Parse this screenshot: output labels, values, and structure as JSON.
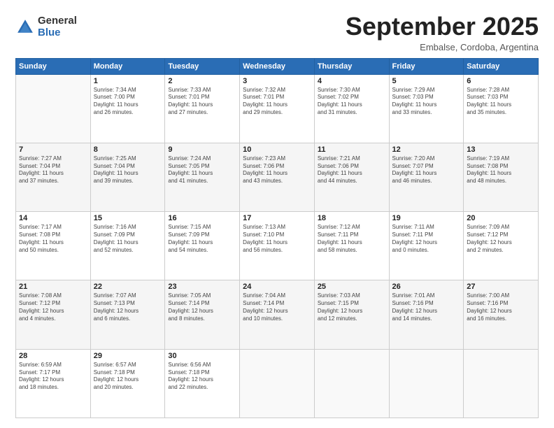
{
  "header": {
    "logo_general": "General",
    "logo_blue": "Blue",
    "title": "September 2025",
    "location": "Embalse, Cordoba, Argentina"
  },
  "days_of_week": [
    "Sunday",
    "Monday",
    "Tuesday",
    "Wednesday",
    "Thursday",
    "Friday",
    "Saturday"
  ],
  "weeks": [
    [
      {
        "day": "",
        "info": ""
      },
      {
        "day": "1",
        "info": "Sunrise: 7:34 AM\nSunset: 7:00 PM\nDaylight: 11 hours\nand 26 minutes."
      },
      {
        "day": "2",
        "info": "Sunrise: 7:33 AM\nSunset: 7:01 PM\nDaylight: 11 hours\nand 27 minutes."
      },
      {
        "day": "3",
        "info": "Sunrise: 7:32 AM\nSunset: 7:01 PM\nDaylight: 11 hours\nand 29 minutes."
      },
      {
        "day": "4",
        "info": "Sunrise: 7:30 AM\nSunset: 7:02 PM\nDaylight: 11 hours\nand 31 minutes."
      },
      {
        "day": "5",
        "info": "Sunrise: 7:29 AM\nSunset: 7:03 PM\nDaylight: 11 hours\nand 33 minutes."
      },
      {
        "day": "6",
        "info": "Sunrise: 7:28 AM\nSunset: 7:03 PM\nDaylight: 11 hours\nand 35 minutes."
      }
    ],
    [
      {
        "day": "7",
        "info": "Sunrise: 7:27 AM\nSunset: 7:04 PM\nDaylight: 11 hours\nand 37 minutes."
      },
      {
        "day": "8",
        "info": "Sunrise: 7:25 AM\nSunset: 7:04 PM\nDaylight: 11 hours\nand 39 minutes."
      },
      {
        "day": "9",
        "info": "Sunrise: 7:24 AM\nSunset: 7:05 PM\nDaylight: 11 hours\nand 41 minutes."
      },
      {
        "day": "10",
        "info": "Sunrise: 7:23 AM\nSunset: 7:06 PM\nDaylight: 11 hours\nand 43 minutes."
      },
      {
        "day": "11",
        "info": "Sunrise: 7:21 AM\nSunset: 7:06 PM\nDaylight: 11 hours\nand 44 minutes."
      },
      {
        "day": "12",
        "info": "Sunrise: 7:20 AM\nSunset: 7:07 PM\nDaylight: 11 hours\nand 46 minutes."
      },
      {
        "day": "13",
        "info": "Sunrise: 7:19 AM\nSunset: 7:08 PM\nDaylight: 11 hours\nand 48 minutes."
      }
    ],
    [
      {
        "day": "14",
        "info": "Sunrise: 7:17 AM\nSunset: 7:08 PM\nDaylight: 11 hours\nand 50 minutes."
      },
      {
        "day": "15",
        "info": "Sunrise: 7:16 AM\nSunset: 7:09 PM\nDaylight: 11 hours\nand 52 minutes."
      },
      {
        "day": "16",
        "info": "Sunrise: 7:15 AM\nSunset: 7:09 PM\nDaylight: 11 hours\nand 54 minutes."
      },
      {
        "day": "17",
        "info": "Sunrise: 7:13 AM\nSunset: 7:10 PM\nDaylight: 11 hours\nand 56 minutes."
      },
      {
        "day": "18",
        "info": "Sunrise: 7:12 AM\nSunset: 7:11 PM\nDaylight: 11 hours\nand 58 minutes."
      },
      {
        "day": "19",
        "info": "Sunrise: 7:11 AM\nSunset: 7:11 PM\nDaylight: 12 hours\nand 0 minutes."
      },
      {
        "day": "20",
        "info": "Sunrise: 7:09 AM\nSunset: 7:12 PM\nDaylight: 12 hours\nand 2 minutes."
      }
    ],
    [
      {
        "day": "21",
        "info": "Sunrise: 7:08 AM\nSunset: 7:12 PM\nDaylight: 12 hours\nand 4 minutes."
      },
      {
        "day": "22",
        "info": "Sunrise: 7:07 AM\nSunset: 7:13 PM\nDaylight: 12 hours\nand 6 minutes."
      },
      {
        "day": "23",
        "info": "Sunrise: 7:05 AM\nSunset: 7:14 PM\nDaylight: 12 hours\nand 8 minutes."
      },
      {
        "day": "24",
        "info": "Sunrise: 7:04 AM\nSunset: 7:14 PM\nDaylight: 12 hours\nand 10 minutes."
      },
      {
        "day": "25",
        "info": "Sunrise: 7:03 AM\nSunset: 7:15 PM\nDaylight: 12 hours\nand 12 minutes."
      },
      {
        "day": "26",
        "info": "Sunrise: 7:01 AM\nSunset: 7:16 PM\nDaylight: 12 hours\nand 14 minutes."
      },
      {
        "day": "27",
        "info": "Sunrise: 7:00 AM\nSunset: 7:16 PM\nDaylight: 12 hours\nand 16 minutes."
      }
    ],
    [
      {
        "day": "28",
        "info": "Sunrise: 6:59 AM\nSunset: 7:17 PM\nDaylight: 12 hours\nand 18 minutes."
      },
      {
        "day": "29",
        "info": "Sunrise: 6:57 AM\nSunset: 7:18 PM\nDaylight: 12 hours\nand 20 minutes."
      },
      {
        "day": "30",
        "info": "Sunrise: 6:56 AM\nSunset: 7:18 PM\nDaylight: 12 hours\nand 22 minutes."
      },
      {
        "day": "",
        "info": ""
      },
      {
        "day": "",
        "info": ""
      },
      {
        "day": "",
        "info": ""
      },
      {
        "day": "",
        "info": ""
      }
    ]
  ]
}
